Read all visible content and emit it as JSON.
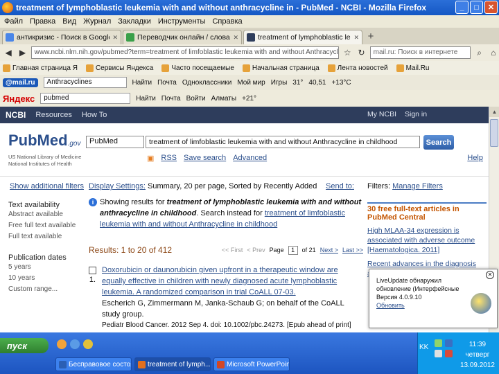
{
  "window": {
    "title": "treatment of lymphoblastic leukemia with and without anthracycline in - PubMed - NCBI - Mozilla Firefox"
  },
  "menu": [
    "Файл",
    "Правка",
    "Вид",
    "Журнал",
    "Закладки",
    "Инструменты",
    "Справка"
  ],
  "tabs": [
    {
      "label": "антикризис - Поиск в Google"
    },
    {
      "label": "Переводчик онлайн / словари - PROMT"
    },
    {
      "label": "treatment of lymphoblastic leukemia with"
    }
  ],
  "address": {
    "url": "www.ncbi.nlm.nih.gov/pubmed?term=treatment of limfoblastic leukemia with and without Anthracycline in childhood",
    "search_placeholder": "mail.ru: Поиск в интернете"
  },
  "bookmarks": [
    "Главная страница Я",
    "Сервисы Яндекса",
    "Часто посещаемые",
    "Начальная страница",
    "Лента новостей",
    "Mail.Ru"
  ],
  "toolbar2": {
    "brand": "@mail.ru",
    "field": "Anthracyclines",
    "find": "Найти",
    "items": [
      "Почта",
      "Одноклассники",
      "Мой мир",
      "Игры",
      "31°",
      "40,51",
      "+13°C"
    ]
  },
  "toolbar3": {
    "brand": "Яндекс",
    "field": "pubmed",
    "find": "Найти",
    "items": [
      "Почта",
      "Войти",
      "Алматы",
      "+21°"
    ]
  },
  "ncbi": {
    "logo": "NCBI",
    "resources": "Resources",
    "howto": "How To",
    "myncbi": "My NCBI",
    "signin": "Sign in"
  },
  "pubmed": {
    "logo": "PubMed",
    "gov": ".gov",
    "sub1": "US National Library of Medicine",
    "sub2": "National Institutes of Health",
    "db": "PubMed",
    "query": "treatment of limfoblastic leukemia with and without Anthracycline in childhood",
    "search_button": "Search",
    "rss": "RSS",
    "save_search": "Save search",
    "advanced": "Advanced",
    "help": "Help"
  },
  "settings": {
    "show_filters": "Show additional filters",
    "display_label": "Display Settings:",
    "display_value": "Summary, 20 per page, Sorted by Recently Added",
    "send_to": "Send to:",
    "filters_label": "Filters:",
    "manage_filters": "Manage Filters"
  },
  "sidebar": {
    "groups": [
      {
        "head": "Text availability",
        "options": [
          "Abstract available",
          "Free full text available",
          "Full text available"
        ]
      },
      {
        "head": "Publication dates",
        "options": [
          "5 years",
          "10 years",
          "Custom range..."
        ]
      }
    ]
  },
  "main": {
    "notice_prefix": "Showing results for",
    "notice_term": "treatment of lymphoblastic leukemia with and without anthracycline in childhood",
    "notice_mid": ". Search instead for",
    "notice_link": "treatment of limfoblastic leukemia with and without Anthracycline in childhood",
    "results": "Results: 1 to 20 of 412",
    "pager": {
      "first": "<< First",
      "prev": "< Prev",
      "page_label": "Page",
      "page": "1",
      "of": "of 21",
      "next": "Next >",
      "last": "Last >>"
    },
    "items": [
      {
        "num": "1.",
        "title": "Doxorubicin or daunorubicin given upfront in a therapeutic window are equally effective in children with newly diagnosed acute lymphoblastic leukemia. A randomized comparison in trial CoALL 07-03.",
        "authors": "Escherich G, Zimmermann M, Janka-Schaub G; on behalf of the CoALL study group.",
        "source": "Pediatr Blood Cancer. 2012 Sep 4. doi: 10.1002/pbc.24273. [Epub ahead of print]"
      }
    ]
  },
  "right": {
    "box_title": "30 free full-text articles in PubMed Central",
    "items": [
      "High MLAA-34 expression is associated with adverse outcome [Haematologica. 2011]",
      "Recent advances in the diagnosis and..."
    ]
  },
  "popup": {
    "line1": "LiveUpdate обнаружил",
    "line2": "обновление (Интерфейсные",
    "line3": "Версия 4.0.9.10",
    "link": "Обновить"
  },
  "taskbar": {
    "start": "пуск",
    "tasks": [
      "Бесправовое состояние",
      "treatment of lymph...",
      "Microsoft PowerPoint..."
    ],
    "lang": "KK",
    "time": "11:39",
    "day": "четверг",
    "date": "13.09.2012"
  }
}
